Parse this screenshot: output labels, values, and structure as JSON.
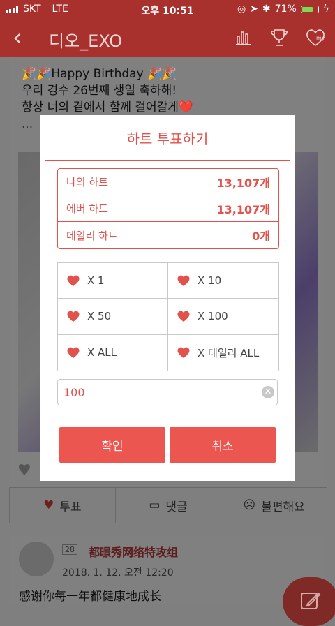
{
  "status_bar": {
    "carrier": "SKT",
    "network": "LTE",
    "time": "오후 10:51",
    "battery": "71%"
  },
  "appbar": {
    "title": "디오_EXO"
  },
  "post": {
    "line1": "🎉🎉Happy Birthday 🎉🎉",
    "line2": "우리 경수 26번째 생일 축하해!",
    "line3": "항상 너의 곁에서 함께 걸어갈게❤️",
    "more": "..."
  },
  "reactions": {
    "vote": "투표",
    "comment": "댓글",
    "uncomfortable": "불편해요"
  },
  "next_post": {
    "badge": "28",
    "author": "都暻秀网络特攻组",
    "date": "2018. 1. 12. 오전 12:20",
    "text": "感谢你每一年都健康地成长"
  },
  "modal": {
    "title": "하트 투표하기",
    "hearts": [
      {
        "label": "나의 하트",
        "value": "13,107개"
      },
      {
        "label": "에버 하트",
        "value": "13,107개"
      },
      {
        "label": "데일리 하트",
        "value": "0개"
      }
    ],
    "options": [
      "X 1",
      "X 10",
      "X 50",
      "X 100",
      "X ALL",
      "X 데일리 ALL"
    ],
    "input_value": "100",
    "confirm": "확인",
    "cancel": "취소"
  },
  "colors": {
    "accent": "#e2524c",
    "button": "#ec5650",
    "appbar": "#a8302d"
  }
}
